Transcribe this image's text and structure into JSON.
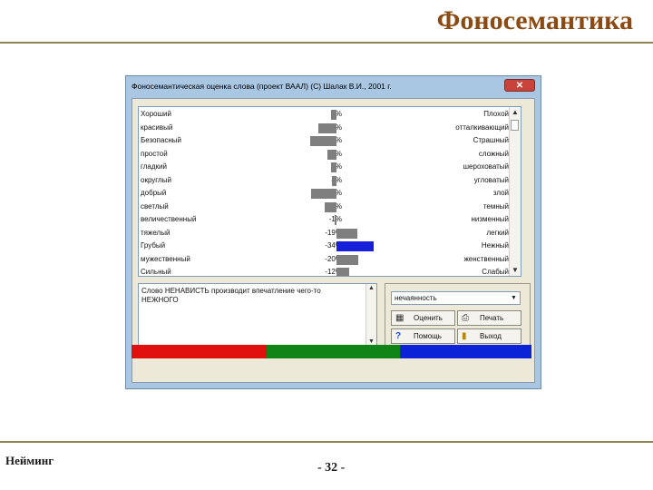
{
  "slide": {
    "title": "Фоносемантика",
    "footer_left": "Нейминг",
    "page": "- 32 -"
  },
  "window": {
    "title": "Фоносемантическая оценка слова (проект ВААЛ) (С) Шалак В.И., 2001 г.",
    "close": "✕"
  },
  "scales": [
    {
      "left": "Хороший",
      "percent": "5%",
      "value": -5,
      "right": "Плохой"
    },
    {
      "left": "красивый",
      "percent": "17%",
      "value": -17,
      "right": "отталкивающий"
    },
    {
      "left": "Безопасный",
      "percent": "24%",
      "value": -24,
      "right": "Страшный"
    },
    {
      "left": "простой",
      "percent": "-8%",
      "value": -8,
      "right": "сложный"
    },
    {
      "left": "гладкий",
      "percent": "5%",
      "value": -5,
      "right": "шероховатый"
    },
    {
      "left": "округлый",
      "percent": "4%",
      "value": -4,
      "right": "угловатый"
    },
    {
      "left": "добрый",
      "percent": "23%",
      "value": -23,
      "right": "злой"
    },
    {
      "left": "светлый",
      "percent": "11%",
      "value": -11,
      "right": "темный"
    },
    {
      "left": "величественный",
      "percent": "-1%",
      "value": -1,
      "right": "низменный"
    },
    {
      "left": "тяжелый",
      "percent": "-19%",
      "value": 19,
      "right": "легкий"
    },
    {
      "left": "Грубый",
      "percent": "-34%",
      "value": 34,
      "right": "Нежный",
      "highlight": true
    },
    {
      "left": "мужественный",
      "percent": "-20%",
      "value": 20,
      "right": "женственный"
    },
    {
      "left": "Сильный",
      "percent": "-12%",
      "value": 12,
      "right": "Слабый"
    }
  ],
  "message": "Слово НЕНАВИСТЬ производит впечатление чего-то НЕЖНОГО",
  "panel": {
    "select_value": "нечаянность",
    "buttons": {
      "evaluate": "Оценить",
      "print": "Печать",
      "help": "Помощь",
      "exit": "Выход"
    }
  },
  "colors": {
    "strip": [
      "#e0100e",
      "#118418",
      "#0b23d6"
    ],
    "bar": "#7f7f7f",
    "highlight_bar": "#1520d8"
  }
}
